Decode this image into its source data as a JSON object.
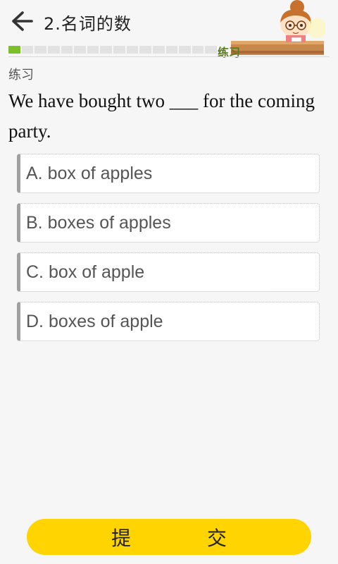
{
  "header": {
    "back_icon": "arrow-left-icon",
    "title": "2.名词的数",
    "mascot_label": "练习",
    "progress": {
      "completed": 1,
      "total": 16
    }
  },
  "section_label": "练习",
  "question": {
    "text": "We have bought two ___ for the coming party."
  },
  "options": [
    {
      "label": "A. box of apples"
    },
    {
      "label": "B. boxes of apples"
    },
    {
      "label": "C. box of apple"
    },
    {
      "label": "D. boxes of apple"
    }
  ],
  "submit_label": "提　交",
  "colors": {
    "accent_yellow": "#ffd400",
    "progress_green": "#7bbf2a",
    "background": "#f6f6f6"
  }
}
